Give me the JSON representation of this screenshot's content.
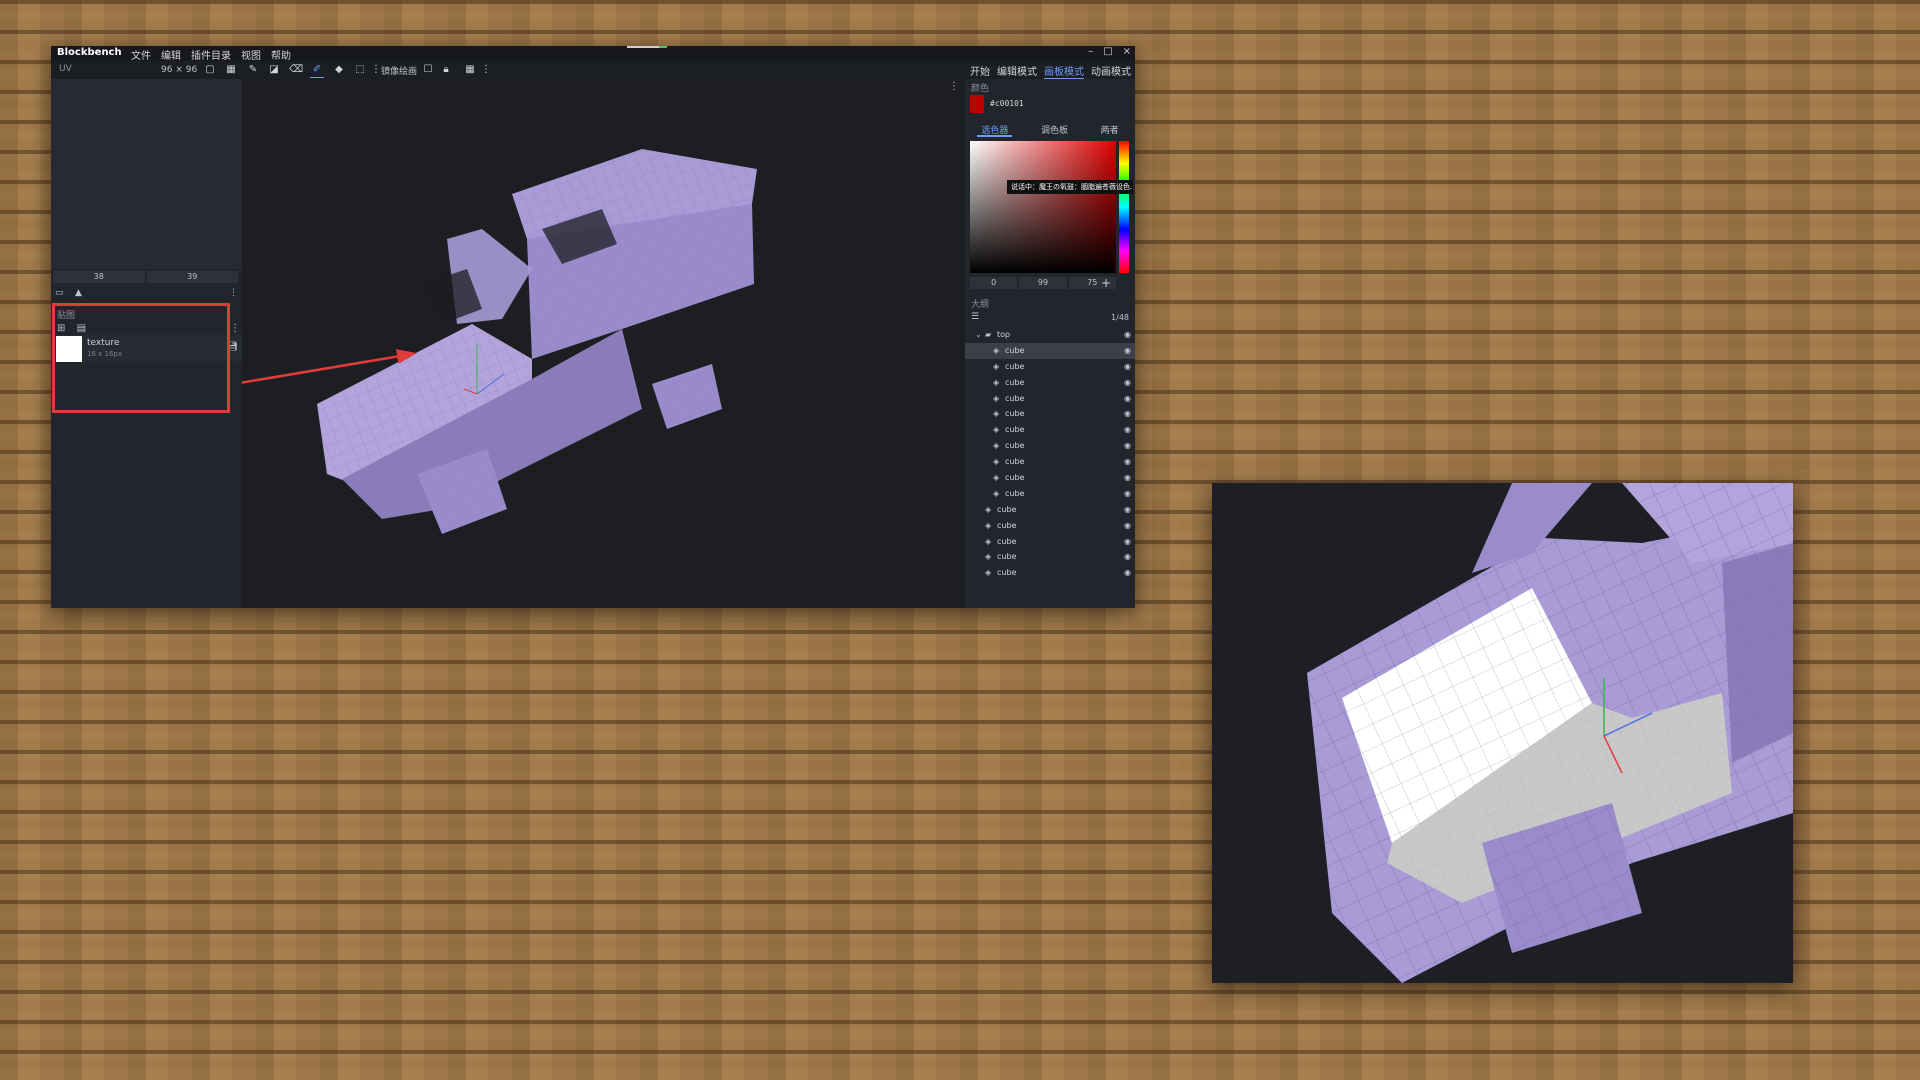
{
  "window": {
    "brand": "Blockbench",
    "menus": [
      "文件",
      "编辑",
      "插件目录",
      "视图",
      "帮助"
    ],
    "controls": [
      "–",
      "□",
      "×"
    ]
  },
  "toolbar": {
    "uv_label": "UV",
    "resolution": "96 × 96",
    "mirror_label": "镜像绘画"
  },
  "modes": [
    "开始",
    "编辑模式",
    "画板模式",
    "动画模式"
  ],
  "uv_panel": {
    "coord_x": "38",
    "coord_y": "39"
  },
  "textures": {
    "title": "贴图",
    "items": [
      {
        "name": "texture",
        "size": "16 x 16px"
      }
    ]
  },
  "color": {
    "title": "颜色",
    "hex": "#c00101",
    "swatch_color": "#c00101",
    "tabs": [
      "选色器",
      "调色板",
      "两者"
    ],
    "active_tab": "选色器",
    "tooltip": "说话中：魔王の氧鼓：胭脂遍苍薇设色...",
    "values": [
      "0",
      "99",
      "75"
    ],
    "add": "+"
  },
  "outliner": {
    "title": "大纲",
    "count": "1/48",
    "group": "top",
    "items": [
      "cube",
      "cube",
      "cube",
      "cube",
      "cube",
      "cube",
      "cube",
      "cube",
      "cube",
      "cube",
      "cube",
      "cube",
      "cube",
      "cube",
      "cube"
    ]
  },
  "annotation_color": "#e23b3b",
  "model_color": "#a99bd6"
}
